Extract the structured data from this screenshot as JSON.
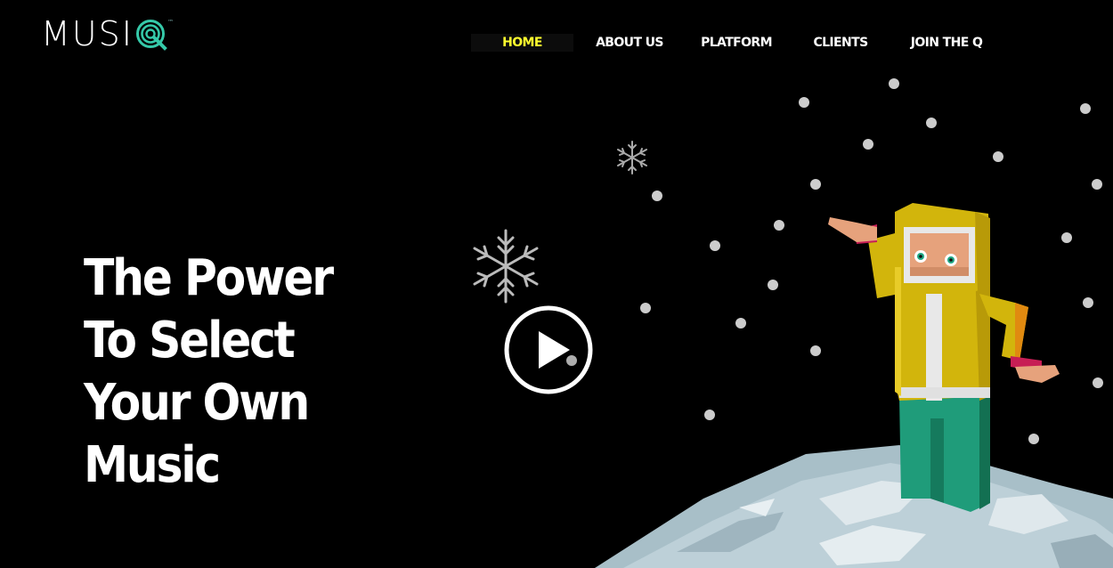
{
  "brand": {
    "logo_text": "MUSI",
    "logo_mark_letter": "Q",
    "trademark": "™",
    "accent_color": "#35c9a9"
  },
  "nav": {
    "items": [
      {
        "label": "HOME",
        "active": true
      },
      {
        "label": "ABOUT US",
        "active": false
      },
      {
        "label": "PLATFORM",
        "active": false
      },
      {
        "label": "CLIENTS",
        "active": false
      },
      {
        "label": "JOIN THE Q",
        "active": false
      }
    ],
    "active_color": "#ffff2e",
    "text_color": "#ffffff"
  },
  "hero": {
    "title_lines": [
      "The Power",
      "To Select",
      "Your Own",
      "Music"
    ]
  },
  "media": {
    "play_icon": "play-icon",
    "illustration": "snowy-character-illustration"
  },
  "colors": {
    "background": "#000000",
    "jacket": "#d2b50c",
    "pants": "#1f9c7a",
    "ice": "#b8ccd4",
    "snow": "#cccccc"
  }
}
